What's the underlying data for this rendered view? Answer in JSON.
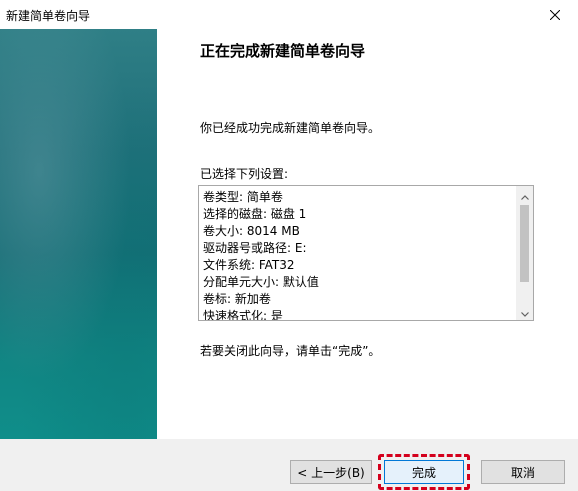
{
  "window": {
    "title": "新建简单卷向导"
  },
  "main": {
    "heading": "正在完成新建简单卷向导",
    "info": "你已经成功完成新建简单卷向导。",
    "selected_label": "已选择下列设置:",
    "summary_lines": [
      "卷类型: 简单卷",
      "选择的磁盘: 磁盘 1",
      "卷大小: 8014 MB",
      "驱动器号或路径: E:",
      "文件系统: FAT32",
      "分配单元大小: 默认值",
      "卷标: 新加卷",
      "快速格式化: 是"
    ],
    "close_hint": "若要关闭此向导，请单击“完成”。"
  },
  "buttons": {
    "back": "< 上一步(B)",
    "finish": "完成",
    "cancel": "取消"
  },
  "icons": {
    "close": "close-icon",
    "scroll_up": "chevron-up-icon",
    "scroll_down": "chevron-down-icon"
  }
}
